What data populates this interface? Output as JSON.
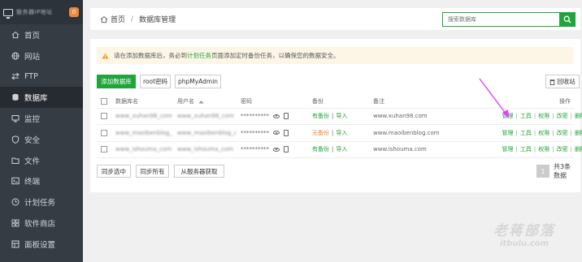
{
  "sidebar": {
    "server_ip": "服务器IP地址",
    "badge": "0",
    "items": [
      {
        "label": "首页",
        "icon": "home-icon"
      },
      {
        "label": "网站",
        "icon": "globe-icon"
      },
      {
        "label": "FTP",
        "icon": "ftp-icon"
      },
      {
        "label": "数据库",
        "icon": "database-icon",
        "active": true
      },
      {
        "label": "监控",
        "icon": "monitor-icon"
      },
      {
        "label": "安全",
        "icon": "shield-icon"
      },
      {
        "label": "文件",
        "icon": "folder-icon"
      },
      {
        "label": "终端",
        "icon": "terminal-icon"
      },
      {
        "label": "计划任务",
        "icon": "clock-icon"
      },
      {
        "label": "软件商店",
        "icon": "apps-icon"
      },
      {
        "label": "面板设置",
        "icon": "gear-icon"
      }
    ]
  },
  "breadcrumb": {
    "home": "首页",
    "separator": "/",
    "current": "数据库管理"
  },
  "search": {
    "placeholder": "搜索数据库"
  },
  "notice": {
    "before": "请在添加数据库后，务必到",
    "link": "计划任务",
    "after": "页面添加定时备份任务，以确保您的数据安全。"
  },
  "toolbar": {
    "add_db": "添加数据库",
    "root_pwd": "root密码",
    "phpmyadmin": "phpMyAdmin",
    "recycle": "回收站"
  },
  "table": {
    "headers": {
      "name": "数据库名",
      "user": "用户名",
      "password": "密码",
      "backup": "备份",
      "note": "备注",
      "ops": "操作"
    },
    "rows": [
      {
        "name": "www_xuhan98_com",
        "user": "www_xuhan98_com",
        "password": "**********",
        "backup_status": "有备份",
        "backup_import": "导入",
        "backup_ok": true,
        "note": "www.xuhan98.com",
        "ops": [
          "管理",
          "工具",
          "权限",
          "改密",
          "删除"
        ]
      },
      {
        "name": "www_maoibenblog_com",
        "user": "www_maoibenblog_com",
        "password": "**********",
        "backup_status": "无备份",
        "backup_import": "导入",
        "backup_ok": false,
        "note": "www.maoibenblog.com",
        "ops": [
          "管理",
          "工具",
          "权限",
          "改密",
          "删除"
        ]
      },
      {
        "name": "www_ishouma_com",
        "user": "www_ishouma_com",
        "password": "**********",
        "backup_status": "有备份",
        "backup_import": "导入",
        "backup_ok": true,
        "note": "www.ishouma.com",
        "ops": [
          "管理",
          "工具",
          "权限",
          "改密",
          "删除"
        ]
      }
    ]
  },
  "footer": {
    "sync_selected": "同步选中",
    "sync_all": "同步所有",
    "from_server": "从服务器获取",
    "page": "1",
    "total": "共3条数据"
  },
  "watermark": {
    "line1": "老蒋部落",
    "line2": "itbulu.com"
  },
  "colors": {
    "accent": "#20a53a",
    "sidebar": "#353c44",
    "warning": "#f0883e",
    "arrow": "#e040fb"
  }
}
